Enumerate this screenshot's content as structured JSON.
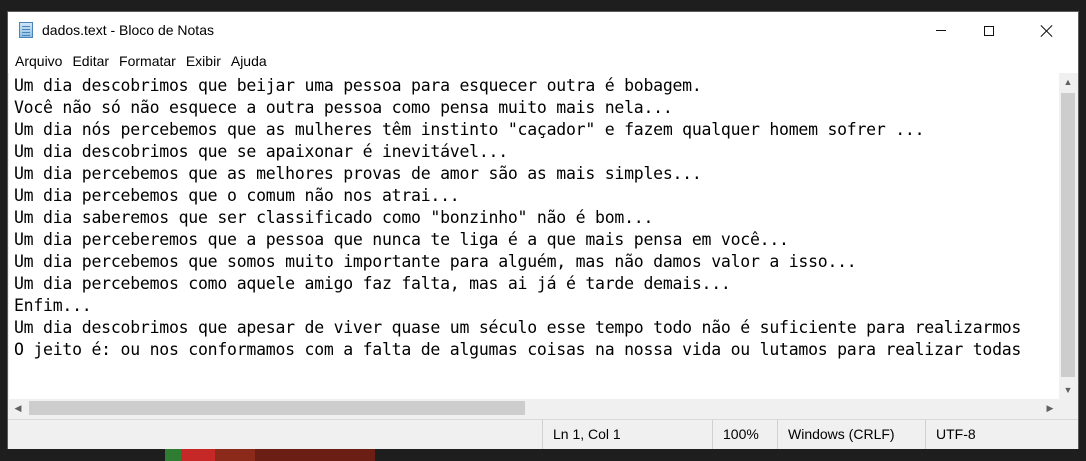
{
  "window": {
    "title": "dados.text - Bloco de Notas"
  },
  "icons": {
    "app": "notepad-icon",
    "minimize": "minimize-icon",
    "maximize": "maximize-icon",
    "close": "close-icon"
  },
  "menu": [
    "Arquivo",
    "Editar",
    "Formatar",
    "Exibir",
    "Ajuda"
  ],
  "content": {
    "lines": [
      "Um dia descobrimos que beijar uma pessoa para esquecer outra é bobagem.",
      "Você não só não esquece a outra pessoa como pensa muito mais nela...",
      "Um dia nós percebemos que as mulheres têm instinto \"caçador\" e fazem qualquer homem sofrer ...",
      "Um dia descobrimos que se apaixonar é inevitável...",
      "Um dia percebemos que as melhores provas de amor são as mais simples...",
      "Um dia percebemos que o comum não nos atrai...",
      "Um dia saberemos que ser classificado como \"bonzinho\" não é bom...",
      "Um dia perceberemos que a pessoa que nunca te liga é a que mais pensa em você...",
      "Um dia percebemos que somos muito importante para alguém, mas não damos valor a isso...",
      "Um dia percebemos como aquele amigo faz falta, mas ai já é tarde demais...",
      "Enfim...",
      "Um dia descobrimos que apesar de viver quase um século esse tempo todo não é suficiente para realizarmos",
      "O jeito é: ou nos conformamos com a falta de algumas coisas na nossa vida ou lutamos para realizar todas"
    ]
  },
  "status": {
    "position": "Ln 1, Col 1",
    "zoom": "100%",
    "line_ending": "Windows (CRLF)",
    "encoding": "UTF-8"
  },
  "colors": {
    "background": "#1e1e1e",
    "window": "#f0f0f0",
    "editor": "#ffffff",
    "taskbar_accents": [
      "#2e7d32",
      "#c62828",
      "#8b2a1a",
      "#6b1f14"
    ]
  }
}
